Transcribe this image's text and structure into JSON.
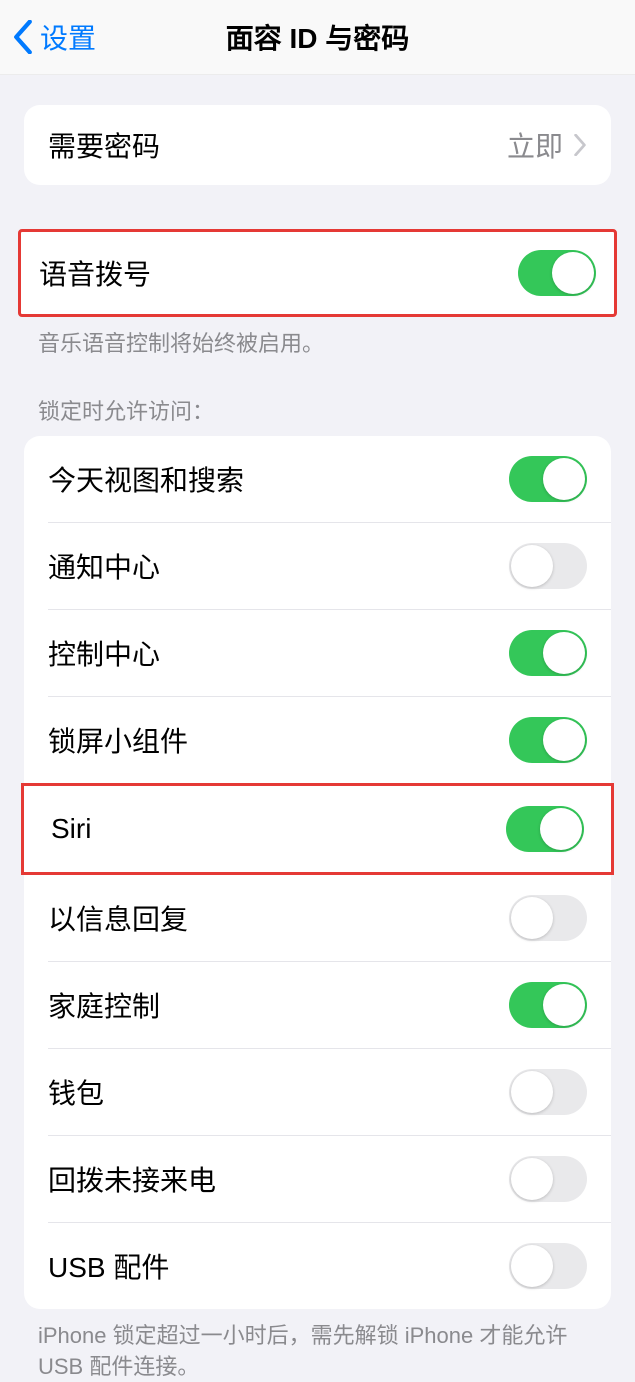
{
  "nav": {
    "back_label": "设置",
    "title": "面容 ID 与密码"
  },
  "require_passcode": {
    "label": "需要密码",
    "value": "立即"
  },
  "voice_dial": {
    "label": "语音拨号",
    "on": true,
    "footer": "音乐语音控制将始终被启用。"
  },
  "lock_access": {
    "header": "锁定时允许访问：",
    "items": [
      {
        "label": "今天视图和搜索",
        "on": true
      },
      {
        "label": "通知中心",
        "on": false
      },
      {
        "label": "控制中心",
        "on": true
      },
      {
        "label": "锁屏小组件",
        "on": true
      },
      {
        "label": "Siri",
        "on": true,
        "highlighted": true
      },
      {
        "label": "以信息回复",
        "on": false
      },
      {
        "label": "家庭控制",
        "on": true
      },
      {
        "label": "钱包",
        "on": false
      },
      {
        "label": "回拨未接来电",
        "on": false
      },
      {
        "label": "USB 配件",
        "on": false
      }
    ],
    "footer": "iPhone 锁定超过一小时后，需先解锁 iPhone 才能允许 USB 配件连接。"
  }
}
